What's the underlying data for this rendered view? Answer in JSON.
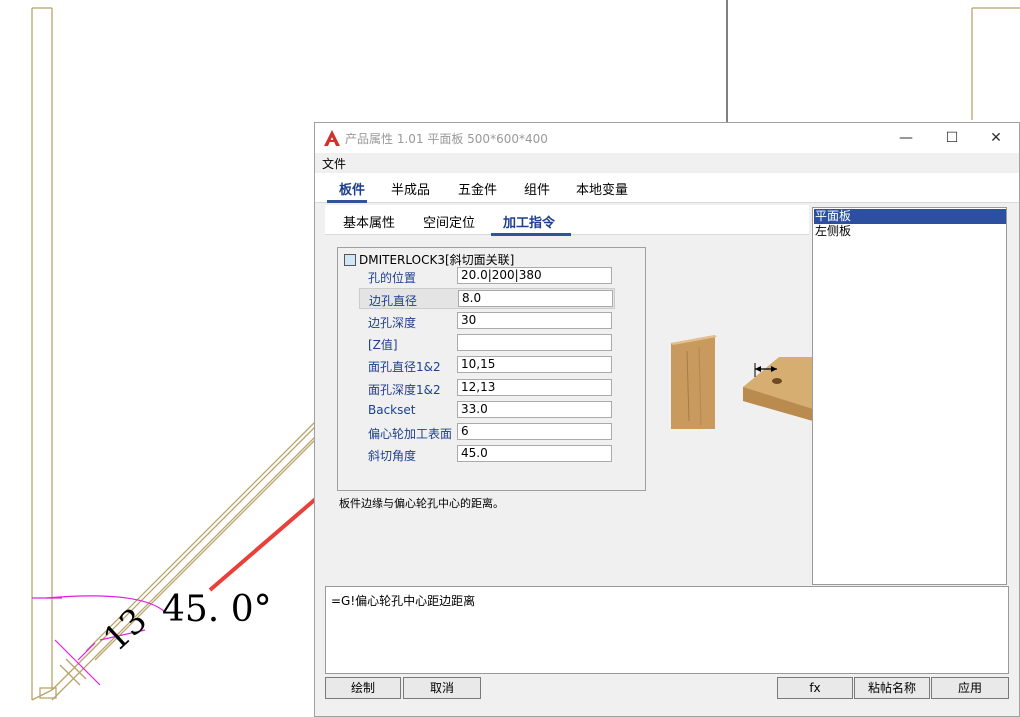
{
  "window": {
    "title": "产品属性 1.01 平面板 500*600*400",
    "minimize_glyph": "—",
    "maximize_glyph": "☐",
    "close_glyph": "✕"
  },
  "menu": {
    "file": "文件"
  },
  "tabs": [
    "板件",
    "半成品",
    "五金件",
    "组件",
    "本地变量"
  ],
  "subtabs": [
    "基本属性",
    "空间定位",
    "加工指令"
  ],
  "property_group": "DMITERLOCK3[斜切面关联]",
  "properties": [
    {
      "label": "孔的位置",
      "value": "20.0|200|380"
    },
    {
      "label": "边孔直径",
      "value": "8.0"
    },
    {
      "label": "边孔深度",
      "value": "30"
    },
    {
      "label": "[Z值]",
      "value": ""
    },
    {
      "label": "面孔直径1&2",
      "value": "10,15"
    },
    {
      "label": "面孔深度1&2",
      "value": "12,13"
    },
    {
      "label": "Backset",
      "value": "33.0"
    },
    {
      "label": "偏心轮加工表面",
      "value": "6"
    },
    {
      "label": "斜切角度",
      "value": "45.0"
    }
  ],
  "description": "板件边缘与偏心轮孔中心的距离。",
  "panel_list": [
    "平面板",
    "左侧板"
  ],
  "formula": "=G!偏心轮孔中心距边距离",
  "buttons": {
    "draw": "绘制",
    "cancel": "取消",
    "fx": "fx",
    "paste_name": "粘帖名称",
    "apply": "应用"
  },
  "cad": {
    "angle_label": "45. 0°",
    "dimension_label": "13"
  },
  "colors": {
    "accent": "#2f5597",
    "selection": "#2c4fa0",
    "cad_line": "#b8a46a",
    "dimension": "#e020e0",
    "arrow": "#e8403a"
  }
}
